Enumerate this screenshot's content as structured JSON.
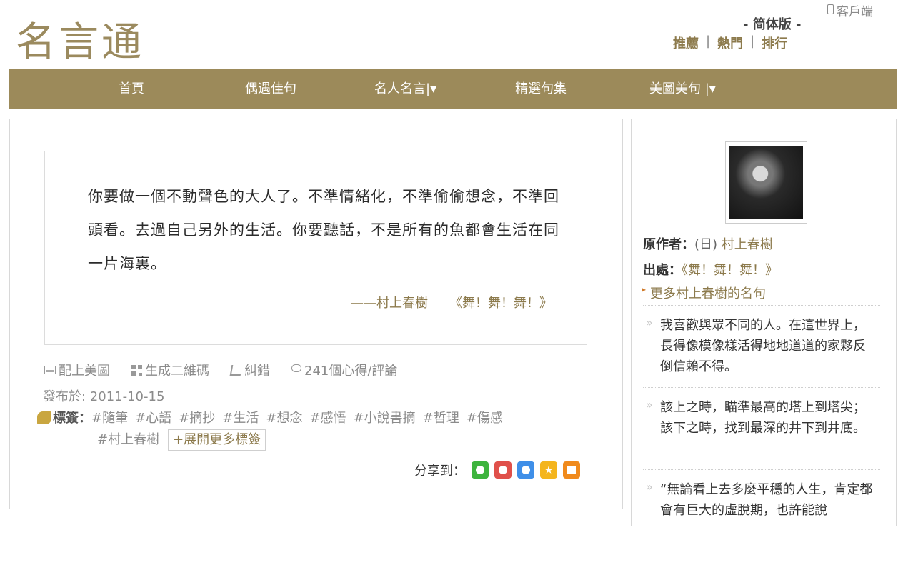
{
  "header": {
    "logo": "名言通",
    "client_label": "客戶端",
    "edition": "- 简体版 -",
    "links": [
      "推薦",
      "熱門",
      "排行"
    ],
    "link_sep": "|"
  },
  "nav": {
    "items": [
      {
        "label": "首頁"
      },
      {
        "label": "偶遇佳句"
      },
      {
        "label": "名人名言|▾"
      },
      {
        "label": "精選句集"
      },
      {
        "label": "美圖美句 |▾"
      }
    ]
  },
  "quote": {
    "text": "你要做一個不動聲色的大人了。不準情緒化，不準偷偷想念，不準回頭看。去過自己另外的生活。你要聽話，不是所有的魚都會生活在同一片海裏。",
    "author": "——村上春樹",
    "book": "《舞！舞！舞！》"
  },
  "actions": {
    "add_image": "配上美圖",
    "qr": "生成二維碼",
    "report": "糾錯",
    "comments": "241個心得/評論"
  },
  "pubdate": "發布於: 2011-10-15",
  "tags": {
    "label": "標簽：",
    "row1": [
      "#隨筆",
      "#心語",
      "#摘抄",
      "#生活",
      "#想念",
      "#感悟",
      "#小說書摘",
      "#哲理",
      "#傷感"
    ],
    "row2": [
      "#村上春樹"
    ],
    "expand": "+展開更多標簽"
  },
  "share": {
    "label": "分享到："
  },
  "sidebar": {
    "author_key": "原作者：",
    "author_prefix": "(日)",
    "author_name": "村上春樹",
    "source_key": "出處：",
    "source_value": "《舞！舞！舞！》",
    "more": "更多村上春樹的名句",
    "quotes": [
      "我喜歡與眾不同的人。在這世界上，長得像模像樣活得地地道道的家夥反倒信賴不得。",
      "該上之時，瞄準最高的塔上到塔尖；該下之時，找到最深的井下到井底。",
      "“無論看上去多麼平穩的人生，肯定都會有巨大的虛脫期，也許能說"
    ]
  },
  "colors": {
    "brand": "#9c8a5a",
    "link": "#8c7a4c"
  }
}
